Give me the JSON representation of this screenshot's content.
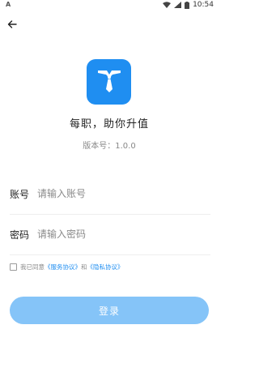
{
  "status_bar": {
    "left_indicator": "A",
    "time": "10:54",
    "icons": [
      "wifi-icon",
      "signal-icon",
      "battery-icon"
    ]
  },
  "header": {
    "back_icon": "arrow-left-icon"
  },
  "app": {
    "logo_icon": "tie-icon",
    "logo_color": "#1f8ef1",
    "slogan": "每职，助你升值",
    "version": "版本号：1.0.0"
  },
  "form": {
    "account": {
      "label": "账号",
      "placeholder": "请输入账号",
      "value": ""
    },
    "password": {
      "label": "密码",
      "placeholder": "请输入密码",
      "value": ""
    }
  },
  "agreement": {
    "checked": false,
    "prefix": "我已同意",
    "service_link": "《服务协议》",
    "conjunction": "和",
    "privacy_link": "《隐私协议》"
  },
  "login_button": {
    "label": "登录",
    "color": "#85c4f8"
  }
}
